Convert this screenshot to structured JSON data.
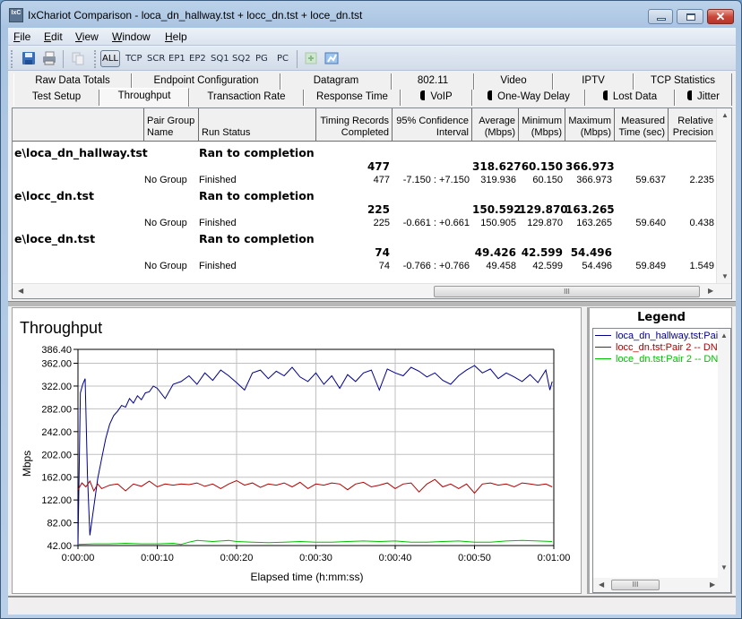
{
  "window": {
    "title": "IxChariot Comparison - loca_dn_hallway.tst + locc_dn.tst + loce_dn.tst",
    "app_icon": "IxC",
    "minimize": "minimize-icon",
    "maximize": "maximize-icon",
    "close": "✕"
  },
  "menu": {
    "items": [
      {
        "label": "File",
        "key": "F",
        "rest": "ile"
      },
      {
        "label": "Edit",
        "key": "E",
        "rest": "dit"
      },
      {
        "label": "View",
        "key": "V",
        "rest": "iew"
      },
      {
        "label": "Window",
        "key": "W",
        "rest": "indow"
      },
      {
        "label": "Help",
        "key": "H",
        "rest": "elp"
      }
    ]
  },
  "toolbar": {
    "icons": [
      "save-icon",
      "print-icon",
      "copy-icon"
    ],
    "filters": [
      "ALL",
      "TCP",
      "SCR",
      "EP1",
      "EP2",
      "SQ1",
      "SQ2",
      "PG",
      "PC"
    ],
    "right_icons": [
      "export-icon",
      "chart-icon"
    ]
  },
  "tabs": {
    "top_row": [
      "Raw Data Totals",
      "Endpoint Configuration",
      "Datagram",
      "802.11",
      "Video",
      "IPTV",
      "TCP Statistics"
    ],
    "bottom_row": [
      "Test Setup",
      "Throughput",
      "Transaction Rate",
      "Response Time",
      "VoIP",
      "One-Way Delay",
      "Lost Data",
      "Jitter"
    ],
    "active": "Throughput"
  },
  "table": {
    "headers": [
      {
        "l1": "",
        "l2": ""
      },
      {
        "l1": "Pair Group",
        "l2": "Name"
      },
      {
        "l1": "",
        "l2": "Run Status"
      },
      {
        "l1": "Timing Records",
        "l2": "Completed"
      },
      {
        "l1": "95% Confidence",
        "l2": "Interval"
      },
      {
        "l1": "Average",
        "l2": "(Mbps)"
      },
      {
        "l1": "Minimum",
        "l2": "(Mbps)"
      },
      {
        "l1": "Maximum",
        "l2": "(Mbps)"
      },
      {
        "l1": "Measured",
        "l2": "Time (sec)"
      },
      {
        "l1": "Relative",
        "l2": "Precision"
      }
    ],
    "groups": [
      {
        "file": "e\\loca_dn_hallway.tst",
        "status": "Ran to completion",
        "summary": {
          "records": "477",
          "avg": "318.627",
          "min": "60.150",
          "max": "366.973"
        },
        "pair": {
          "group": "No Group",
          "status": "Finished",
          "records": "477",
          "ci": "-7.150 : +7.150",
          "avg": "319.936",
          "min": "60.150",
          "max": "366.973",
          "time": "59.637",
          "precision": "2.235"
        }
      },
      {
        "file": "e\\locc_dn.tst",
        "status": "Ran to completion",
        "summary": {
          "records": "225",
          "avg": "150.592",
          "min": "129.870",
          "max": "163.265"
        },
        "pair": {
          "group": "No Group",
          "status": "Finished",
          "records": "225",
          "ci": "-0.661 : +0.661",
          "avg": "150.905",
          "min": "129.870",
          "max": "163.265",
          "time": "59.640",
          "precision": "0.438"
        }
      },
      {
        "file": "e\\loce_dn.tst",
        "status": "Ran to completion",
        "summary": {
          "records": "74",
          "avg": "49.426",
          "min": "42.599",
          "max": "54.496"
        },
        "pair": {
          "group": "No Group",
          "status": "Finished",
          "records": "74",
          "ci": "-0.766 : +0.766",
          "avg": "49.458",
          "min": "42.599",
          "max": "54.496",
          "time": "59.849",
          "precision": "1.549"
        }
      }
    ],
    "hscroll_thumb": "III"
  },
  "legend": {
    "title": "Legend",
    "entries": [
      {
        "label": "loca_dn_hallway.tst:Pair",
        "color": "#00008b"
      },
      {
        "label": "locc_dn.tst:Pair 2 -- DN",
        "color": "#b00000"
      },
      {
        "label": "loce_dn.tst:Pair 2 -- DN",
        "color": "#00c000"
      }
    ],
    "hscroll_thumb": "III"
  },
  "chart_data": {
    "type": "line",
    "title": "Throughput",
    "xlabel": "Elapsed time (h:mm:ss)",
    "ylabel": "Mbps",
    "xlim": [
      0,
      60
    ],
    "ylim": [
      42.0,
      386.4
    ],
    "x_ticks": [
      "0:00:00",
      "0:00:10",
      "0:00:20",
      "0:00:30",
      "0:00:40",
      "0:00:50",
      "0:01:00"
    ],
    "y_ticks": [
      "42.00",
      "82.00",
      "122.00",
      "162.00",
      "202.00",
      "242.00",
      "282.00",
      "322.00",
      "362.00",
      "386.40"
    ],
    "y_tick_values": [
      42,
      82,
      122,
      162,
      202,
      242,
      282,
      322,
      362,
      386.4
    ],
    "grid": true,
    "legend_position": "right-panel",
    "series": [
      {
        "name": "loca_dn_hallway.tst:Pair",
        "color": "#00008b",
        "x": [
          0,
          0.3,
          0.6,
          0.9,
          1.2,
          1.5,
          2.0,
          2.5,
          3.0,
          3.5,
          4.0,
          4.5,
          5.0,
          5.5,
          6.0,
          6.5,
          7.0,
          7.5,
          8.0,
          8.5,
          9.0,
          9.5,
          10.0,
          11.0,
          12.0,
          13.0,
          14.0,
          15.0,
          16.0,
          17.0,
          18.0,
          19.0,
          20.0,
          21.0,
          22.0,
          23.0,
          24.0,
          25.0,
          26.0,
          27.0,
          28.0,
          29.0,
          30.0,
          31.0,
          32.0,
          33.0,
          34.0,
          35.0,
          36.0,
          37.0,
          38.0,
          39.0,
          40.0,
          41.0,
          42.0,
          43.0,
          44.0,
          45.0,
          46.0,
          47.0,
          48.0,
          49.0,
          50.0,
          51.0,
          52.0,
          53.0,
          54.0,
          55.0,
          56.0,
          57.0,
          58.0,
          59.0,
          59.5,
          59.8
        ],
        "values": [
          42,
          310,
          325,
          335,
          165,
          60,
          110,
          160,
          195,
          230,
          255,
          270,
          278,
          288,
          285,
          300,
          292,
          305,
          298,
          310,
          312,
          322,
          318,
          300,
          325,
          330,
          340,
          325,
          345,
          332,
          350,
          340,
          328,
          315,
          345,
          350,
          335,
          348,
          340,
          355,
          338,
          330,
          345,
          325,
          340,
          318,
          342,
          330,
          345,
          350,
          315,
          352,
          345,
          340,
          355,
          348,
          338,
          345,
          332,
          325,
          340,
          350,
          358,
          345,
          352,
          335,
          345,
          338,
          330,
          342,
          328,
          350,
          315,
          330
        ]
      },
      {
        "name": "locc_dn.tst:Pair 2 -- DN",
        "color": "#b00000",
        "x": [
          0,
          0.5,
          1,
          1.5,
          2,
          2.5,
          3,
          4,
          5,
          6,
          7,
          8,
          9,
          10,
          11,
          12,
          13,
          14,
          15,
          16,
          17,
          18,
          19,
          20,
          21,
          22,
          23,
          24,
          25,
          26,
          27,
          28,
          29,
          30,
          31,
          32,
          33,
          34,
          35,
          36,
          37,
          38,
          39,
          40,
          41,
          42,
          43,
          44,
          45,
          46,
          47,
          48,
          49,
          50,
          51,
          52,
          53,
          54,
          55,
          56,
          57,
          58,
          59,
          59.8
        ],
        "values": [
          140,
          152,
          145,
          155,
          138,
          150,
          142,
          148,
          150,
          138,
          150,
          146,
          155,
          145,
          150,
          148,
          150,
          149,
          152,
          146,
          150,
          142,
          150,
          156,
          148,
          152,
          144,
          150,
          148,
          152,
          145,
          153,
          142,
          150,
          148,
          152,
          150,
          140,
          150,
          153,
          145,
          148,
          152,
          142,
          150,
          152,
          136,
          150,
          158,
          145,
          150,
          142,
          150,
          134,
          150,
          152,
          148,
          150,
          145,
          152,
          150,
          148,
          150,
          145
        ]
      },
      {
        "name": "loce_dn.tst:Pair 2 -- DN",
        "color": "#00c000",
        "x": [
          0,
          2,
          4,
          6,
          8,
          10,
          12,
          13,
          14,
          15,
          16,
          17,
          18,
          19,
          20,
          22,
          24,
          26,
          28,
          30,
          32,
          34,
          36,
          38,
          40,
          42,
          44,
          46,
          48,
          50,
          52,
          54,
          56,
          58,
          59.8
        ],
        "values": [
          44,
          45,
          45,
          46,
          45,
          45,
          46,
          44,
          48,
          51,
          50,
          49,
          50,
          51,
          49,
          48,
          47,
          48,
          49,
          48,
          48,
          49,
          50,
          49,
          50,
          48,
          48,
          49,
          50,
          48,
          48,
          50,
          51,
          50,
          49
        ]
      }
    ]
  }
}
